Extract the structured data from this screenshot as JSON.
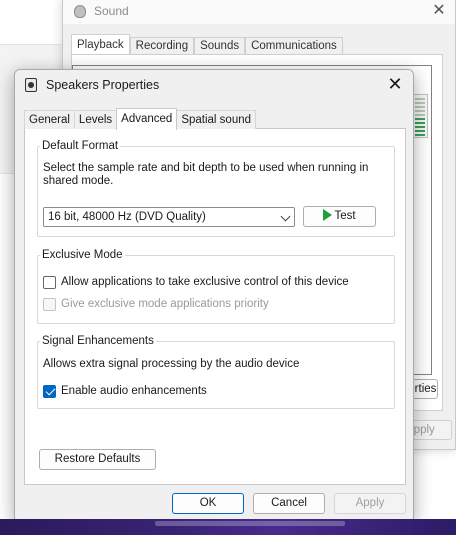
{
  "background_window": {
    "title": "Sound",
    "close": "✕",
    "tabs": [
      "Playback",
      "Recording",
      "Sounds",
      "Communications"
    ],
    "properties_button": "Properties",
    "apply_button": "Apply"
  },
  "dialog": {
    "title": "Speakers Properties",
    "close": "✕",
    "tabs": [
      "General",
      "Levels",
      "Advanced",
      "Spatial sound"
    ],
    "active_tab": "Advanced",
    "default_format": {
      "label": "Default Format",
      "description": "Select the sample rate and bit depth to be used when running in shared mode.",
      "selected_format": "16 bit, 48000 Hz (DVD Quality)",
      "test_button": "Test"
    },
    "exclusive_mode": {
      "label": "Exclusive Mode",
      "allow_exclusive": {
        "label": "Allow applications to take exclusive control of this device",
        "checked": false
      },
      "give_priority": {
        "label": "Give exclusive mode applications priority",
        "checked": false,
        "disabled": true
      }
    },
    "signal_enhancements": {
      "label": "Signal Enhancements",
      "description": "Allows extra signal processing by the audio device",
      "enable_enhancements": {
        "label": "Enable audio enhancements",
        "checked": true
      }
    },
    "restore_defaults_button": "Restore Defaults",
    "ok_button": "OK",
    "cancel_button": "Cancel",
    "apply_button": "Apply"
  }
}
